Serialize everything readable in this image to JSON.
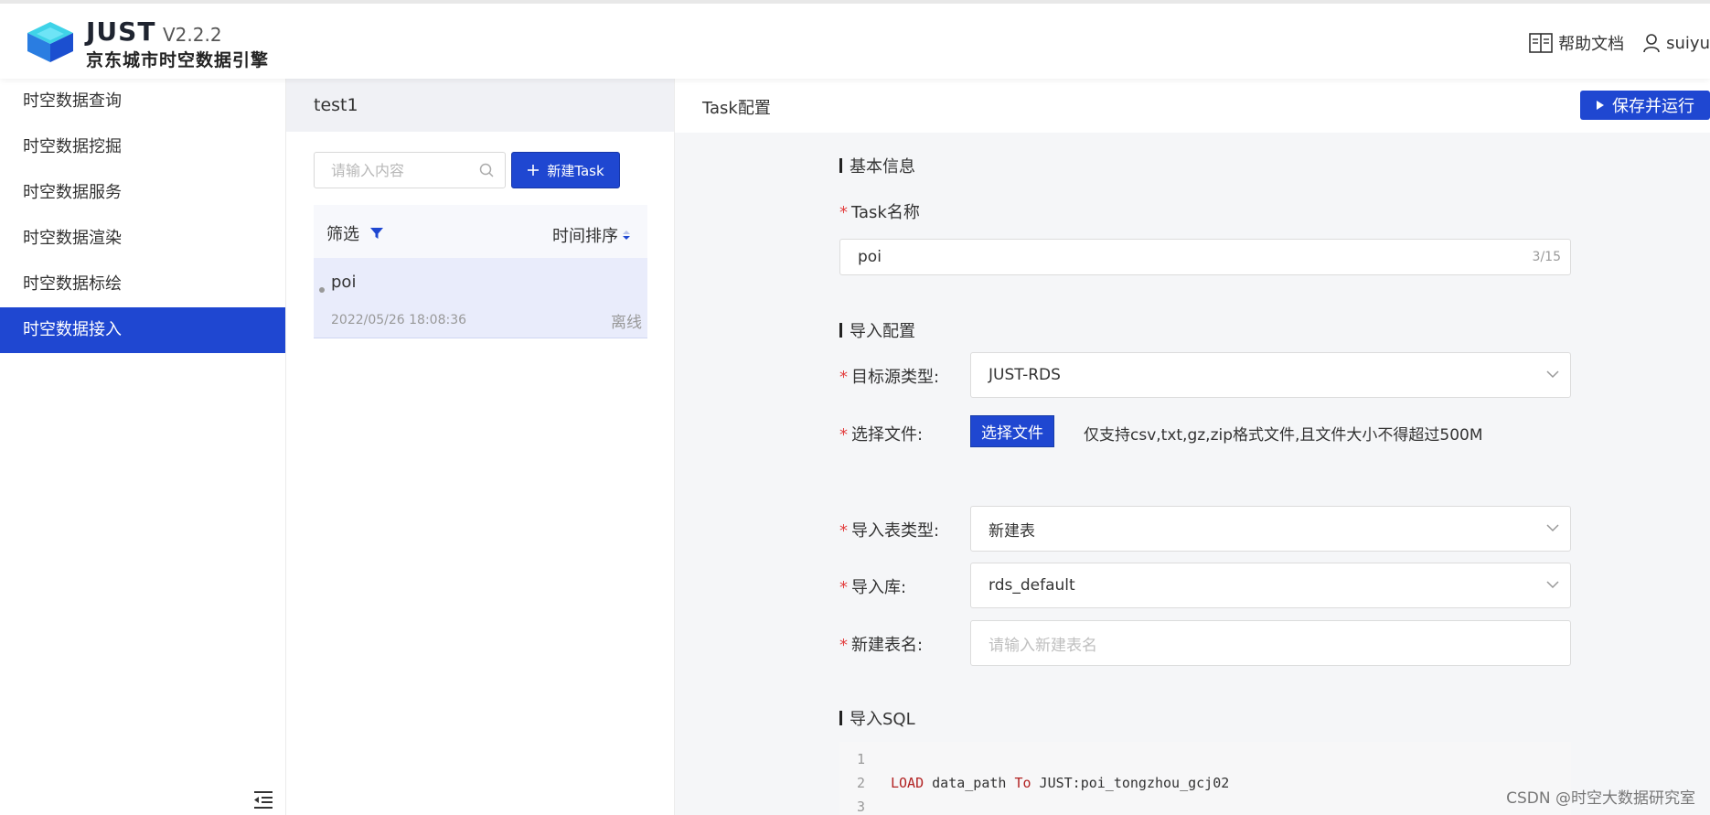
{
  "header": {
    "brand_name": "JUST",
    "version": "V2.2.2",
    "subtitle": "京东城市时空数据引擎",
    "help_label": "帮助文档",
    "user_name": "suiyu"
  },
  "sidebar": {
    "items": [
      {
        "label": "时空数据查询"
      },
      {
        "label": "时空数据挖掘"
      },
      {
        "label": "时空数据服务"
      },
      {
        "label": "时空数据渲染"
      },
      {
        "label": "时空数据标绘"
      },
      {
        "label": "时空数据接入"
      }
    ],
    "active_index": 5
  },
  "task_panel": {
    "title": "test1",
    "search_placeholder": "请输入内容",
    "new_button_label": "新建Task",
    "filter_label": "筛选",
    "sort_label": "时间排序",
    "tasks": [
      {
        "name": "poi",
        "time": "2022/05/26 18:08:36",
        "status": "离线"
      }
    ]
  },
  "config": {
    "title": "Task配置",
    "run_button_label": "保存并运行",
    "basic_section": "基本信息",
    "task_name_label": "Task名称",
    "task_name_value": "poi",
    "task_name_counter": "3/15",
    "import_section": "导入配置",
    "target_type_label": "目标源类型:",
    "target_type_value": "JUST-RDS",
    "file_label": "选择文件:",
    "file_button_label": "选择文件",
    "file_hint": "仅支持csv,txt,gz,zip格式文件,且文件大小不得超过500M",
    "table_type_label": "导入表类型:",
    "table_type_value": "新建表",
    "db_label": "导入库:",
    "db_value": "rds_default",
    "new_table_label": "新建表名:",
    "new_table_placeholder": "请输入新建表名",
    "sql_section": "导入SQL",
    "sql_line_numbers": [
      "1",
      "2",
      "3"
    ],
    "sql_keyword_load": "LOAD",
    "sql_part_1": " data_path ",
    "sql_keyword_to": "To",
    "sql_part_2": " JUST:poi_tongzhou_gcj02"
  },
  "watermark": "CSDN @时空大数据研究室",
  "colors": {
    "accent": "#1f47d1",
    "required": "#e34040"
  }
}
